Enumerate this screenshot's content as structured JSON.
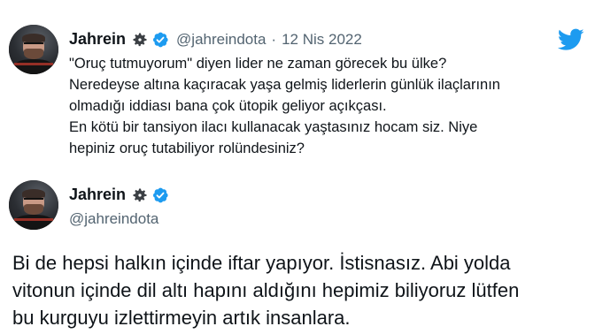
{
  "quoted_tweet": {
    "author_name": "Jahrein",
    "handle": "@jahreindota",
    "separator": "·",
    "date": "12 Nis 2022",
    "lines": [
      "\"Oruç tutmuyorum\" diyen lider ne zaman görecek bu ülke?",
      "Neredeyse altına kaçıracak yaşa gelmiş liderlerin günlük ilaçlarının",
      "olmadığı iddiası bana çok ütopik geliyor açıkçası.",
      "En kötü bir tansiyon ilacı kullanacak yaştasınız hocam siz. Niye",
      "hepiniz oruç tutabiliyor rolündesiniz?"
    ]
  },
  "main_tweet": {
    "author_name": "Jahrein",
    "handle": "@jahreindota",
    "lines": [
      "Bi de hepsi halkın içinde iftar yapıyor. İstisnasız. Abi yolda",
      "vitonun içinde dil altı hapını aldığını hepimiz biliyoruz lütfen",
      "bu kurguyu izlettirmeyin artık insanlara."
    ]
  },
  "icons": {
    "gear": "gear-icon",
    "verified": "verified-badge-icon",
    "brand": "twitter-bird-icon"
  },
  "colors": {
    "verified": "#1d9bf0",
    "twitter_blue": "#1d9bf0",
    "secondary_text": "#536471",
    "primary_text": "#0f1419"
  }
}
